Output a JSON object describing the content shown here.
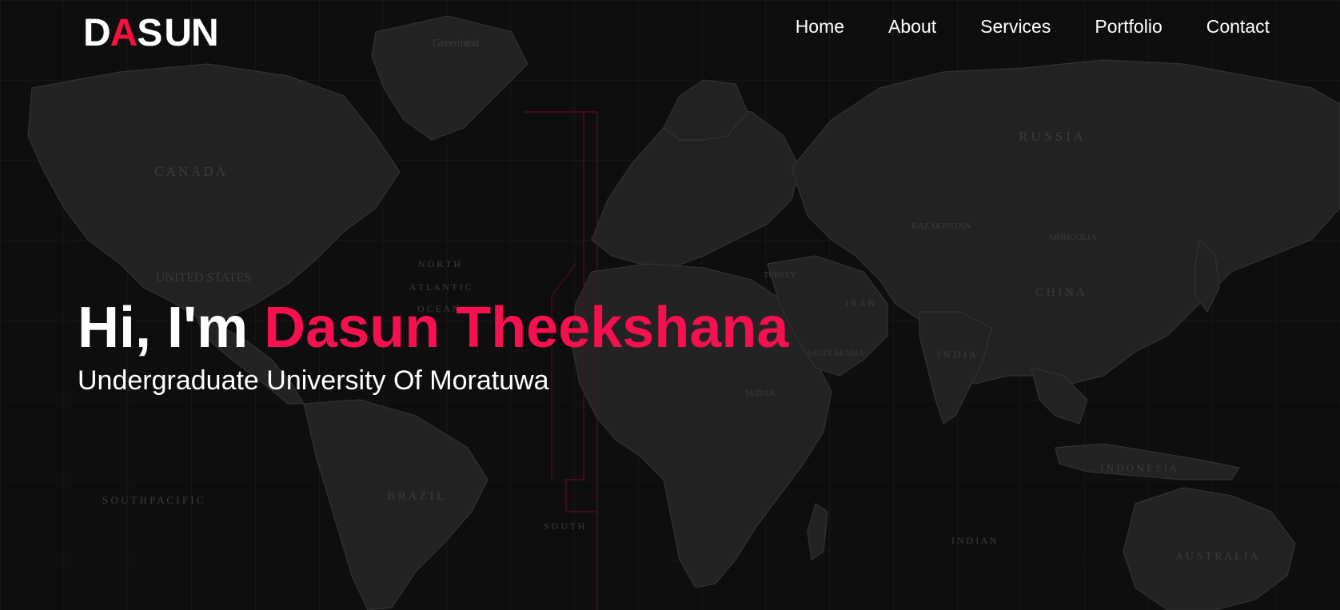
{
  "logo": {
    "letters": [
      "D",
      "A",
      "S",
      "U",
      "N"
    ],
    "accent_color": "#f5103f"
  },
  "nav": {
    "items": [
      "Home",
      "About",
      "Services",
      "Portfolio",
      "Contact"
    ]
  },
  "hero": {
    "greeting": "Hi, I'm",
    "name": "Dasun Theekshana",
    "name_color": "#f5104f",
    "subtitle": "Undergraduate University Of Moratuwa"
  },
  "map": {
    "labels": {
      "greenland": "Greenland",
      "canada": "C A N A D A",
      "united_states": "UNITED STATES",
      "russia": "R U S S I A",
      "china": "C H I N A",
      "kazakhstan": "KAZAKHSTAN",
      "mongolia": "MONGOLIA",
      "brazil": "B R A Z I L",
      "australia": "A U S T R A L I A",
      "indonesia": "I N D O N E S I A",
      "india": "I N D I A",
      "north_atlantic": "N O R T H",
      "atlantic": "A T L A N T I C",
      "ocean": "O C E A N",
      "south_pacific": "S O U T H   P A C I F I C",
      "south": "S O U T H",
      "indian": "I N D I A N",
      "iran": "I R A N",
      "sudan": "SUDAN",
      "turkey": "TURKEY",
      "saudi_arabia": "SAUDI ARABIA"
    }
  }
}
